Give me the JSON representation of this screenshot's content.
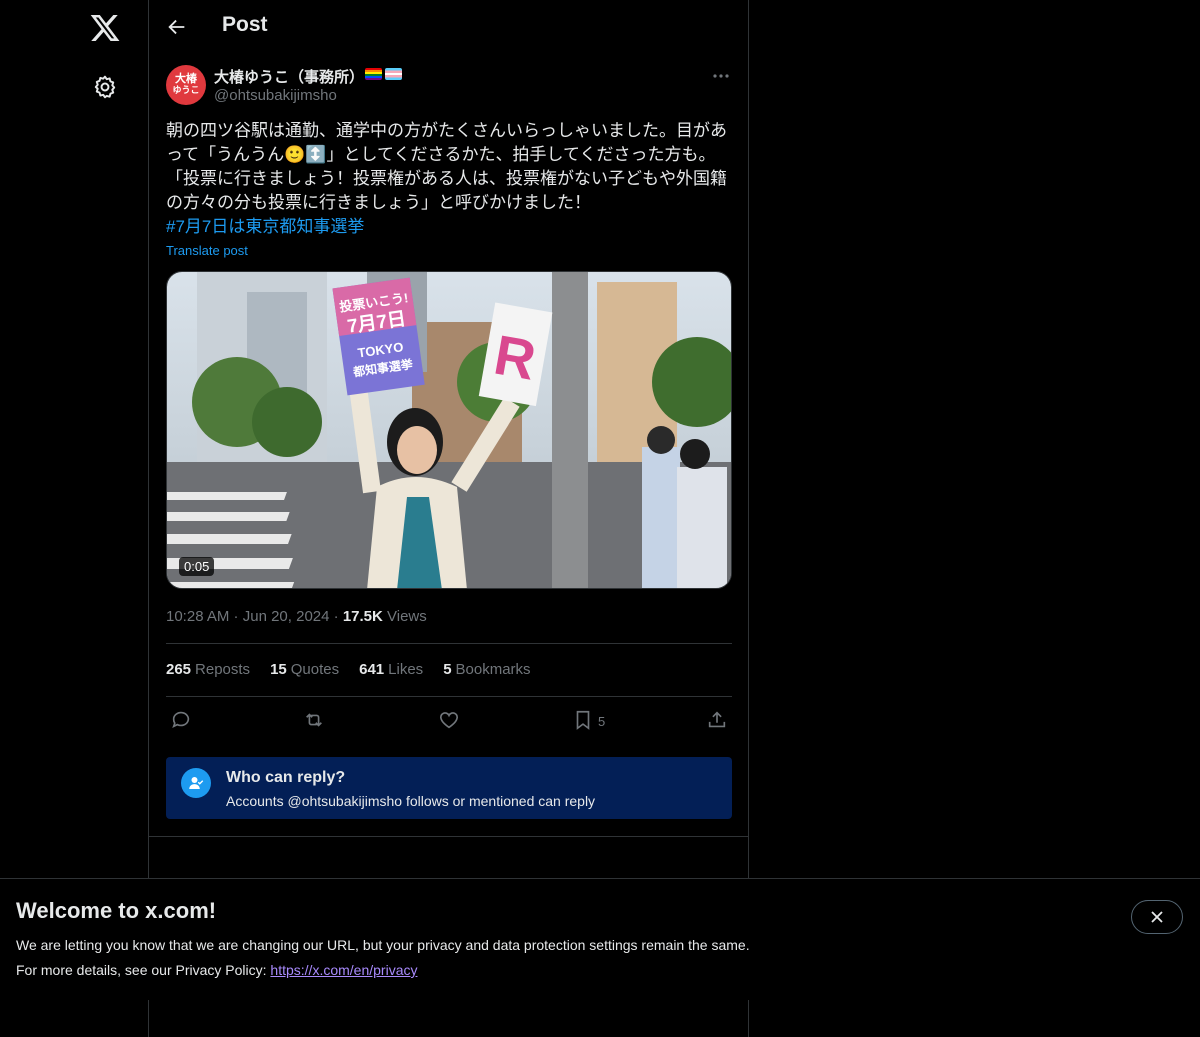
{
  "header": {
    "title": "Post"
  },
  "author": {
    "avatar_text_top": "大椿",
    "avatar_text_bottom": "ゆうこ",
    "name": "大椿ゆうこ（事務所）",
    "handle": "@ohtsubakijimsho",
    "flags": [
      "rainbow-flag",
      "transgender-flag"
    ]
  },
  "post": {
    "line1": "朝の四ツ谷駅は通勤、通学中の方がたくさんいらっしゃいました。目があ",
    "line2": "って「うんうん🙂↕️」としてくださるかた、拍手してくださった方も。",
    "line3": "「投票に行きましょう！投票権がある人は、投票権がない子どもや外国籍",
    "line4": "の方々の分も投票に行きましょう」と呼びかけました！",
    "hashtag": "#7月7日は東京都知事選挙",
    "translate": "Translate post"
  },
  "media": {
    "duration": "0:05",
    "sign_text_1": "投票いこう!",
    "sign_text_2": "7月7日",
    "sign_text_3": "TOKYO",
    "sign_text_4": "都知事選挙",
    "sign_letter": "R"
  },
  "meta": {
    "time": "10:28 AM",
    "sep1": " · ",
    "date": "Jun 20, 2024",
    "sep2": " · ",
    "views_count": "17.5K",
    "views_label": " Views"
  },
  "stats": [
    {
      "count": "265",
      "label": "Reposts"
    },
    {
      "count": "15",
      "label": "Quotes"
    },
    {
      "count": "641",
      "label": "Likes"
    },
    {
      "count": "5",
      "label": "Bookmarks"
    }
  ],
  "actions": {
    "bookmark_count": "5",
    "icons": [
      "reply-icon",
      "repost-icon",
      "like-icon",
      "bookmark-icon",
      "share-icon"
    ]
  },
  "reply_restriction": {
    "title": "Who can reply?",
    "subtitle": "Accounts @ohtsubakijimsho follows or mentioned can reply"
  },
  "banner": {
    "title": "Welcome to x.com!",
    "line1": "We are letting you know that we are changing our URL, but your privacy and data protection settings remain the same.",
    "line2_prefix": "For more details, see our Privacy Policy: ",
    "link": "https://x.com/en/privacy"
  },
  "colors": {
    "background": "#000000",
    "text": "#e7e9ea",
    "muted": "#71767b",
    "accent": "#1d9bf0",
    "border": "#2f3336",
    "reply_box": "#031f56",
    "link_visited": "#a98bfd"
  }
}
